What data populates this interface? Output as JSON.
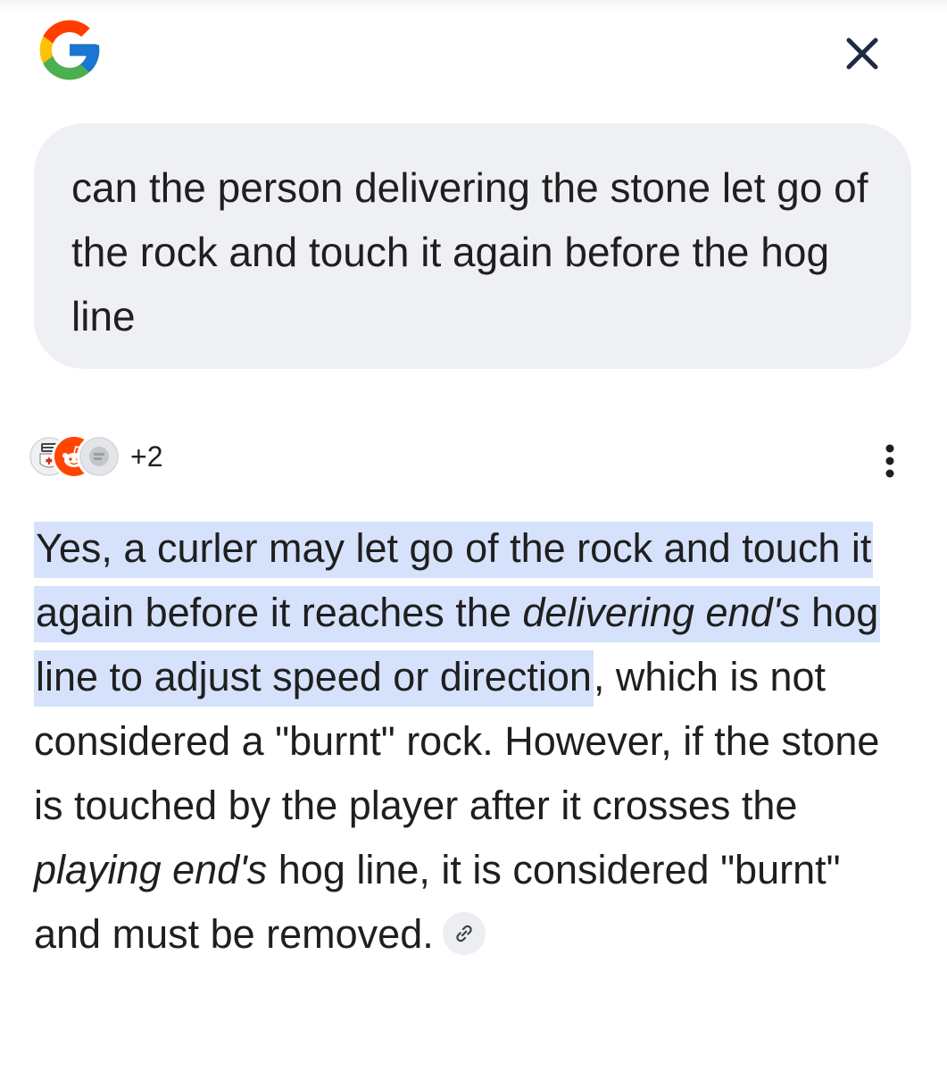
{
  "header": {
    "logo_icon": "google-g-logo",
    "close_icon": "close-icon"
  },
  "query": {
    "text": "can the person delivering the stone let go of the rock and touch it again before the hog line"
  },
  "sources": {
    "icons": [
      "curling-canada-icon",
      "reddit-icon",
      "generic-site-icon"
    ],
    "more_count": "+2",
    "menu_icon": "more-vert-icon"
  },
  "answer": {
    "hl_1": "Yes, a curler may let go of the rock and touch it again before it reaches the ",
    "hl_2_italic": "delivering end's",
    "hl_3": " hog line to adjust speed or direction",
    "p_1": ", which is not considered a \"burnt\" rock. However, if the stone is touched by the player after it crosses the ",
    "p_2_italic": "playing end's",
    "p_3": " hog line, it is considered \"burnt\" and must be removed.",
    "link_icon": "link-icon"
  },
  "colors": {
    "highlight": "#d6e2fb",
    "bubble": "#eef0f3",
    "text": "#1f1f1f",
    "reddit": "#ff4500",
    "canada_red": "#d52b1e"
  }
}
